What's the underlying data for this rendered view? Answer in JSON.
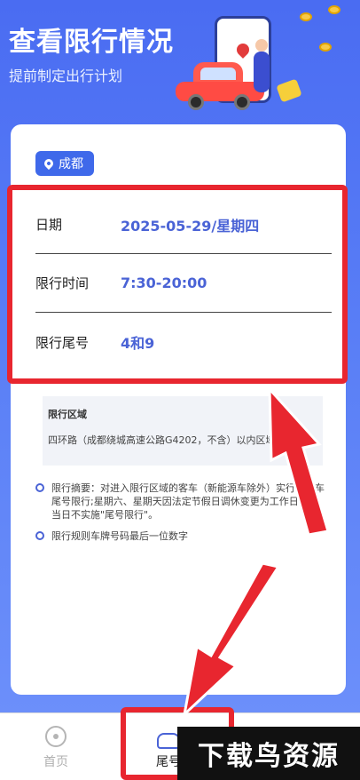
{
  "header": {
    "title": "查看限行情况",
    "subtitle": "提前制定出行计划"
  },
  "city": {
    "label": "成都"
  },
  "restriction": {
    "rows": [
      {
        "label": "日期",
        "value": "2025-05-29/星期四"
      },
      {
        "label": "限行时间",
        "value": "7:30-20:00"
      },
      {
        "label": "限行尾号",
        "value": "4和9"
      }
    ]
  },
  "zone": {
    "title": "限行区域",
    "text": "四环路（成都绕城高速公路G4202，不含）以内区域道路。"
  },
  "notes": [
    "限行摘要：对进入限行区域的客车（新能源车除外）实行机动车尾号限行;星期六、星期天因法定节假日调休变更为工作日的，当日不实施\"尾号限行\"。",
    "限行规则车牌号码最后一位数字"
  ],
  "tabs": [
    {
      "label": "首页"
    },
    {
      "label": "尾号"
    }
  ],
  "watermark": "下载鸟资源",
  "colors": {
    "accent": "#4a63d6",
    "annotation": "#e8262f",
    "background": "#4a6cf2"
  }
}
